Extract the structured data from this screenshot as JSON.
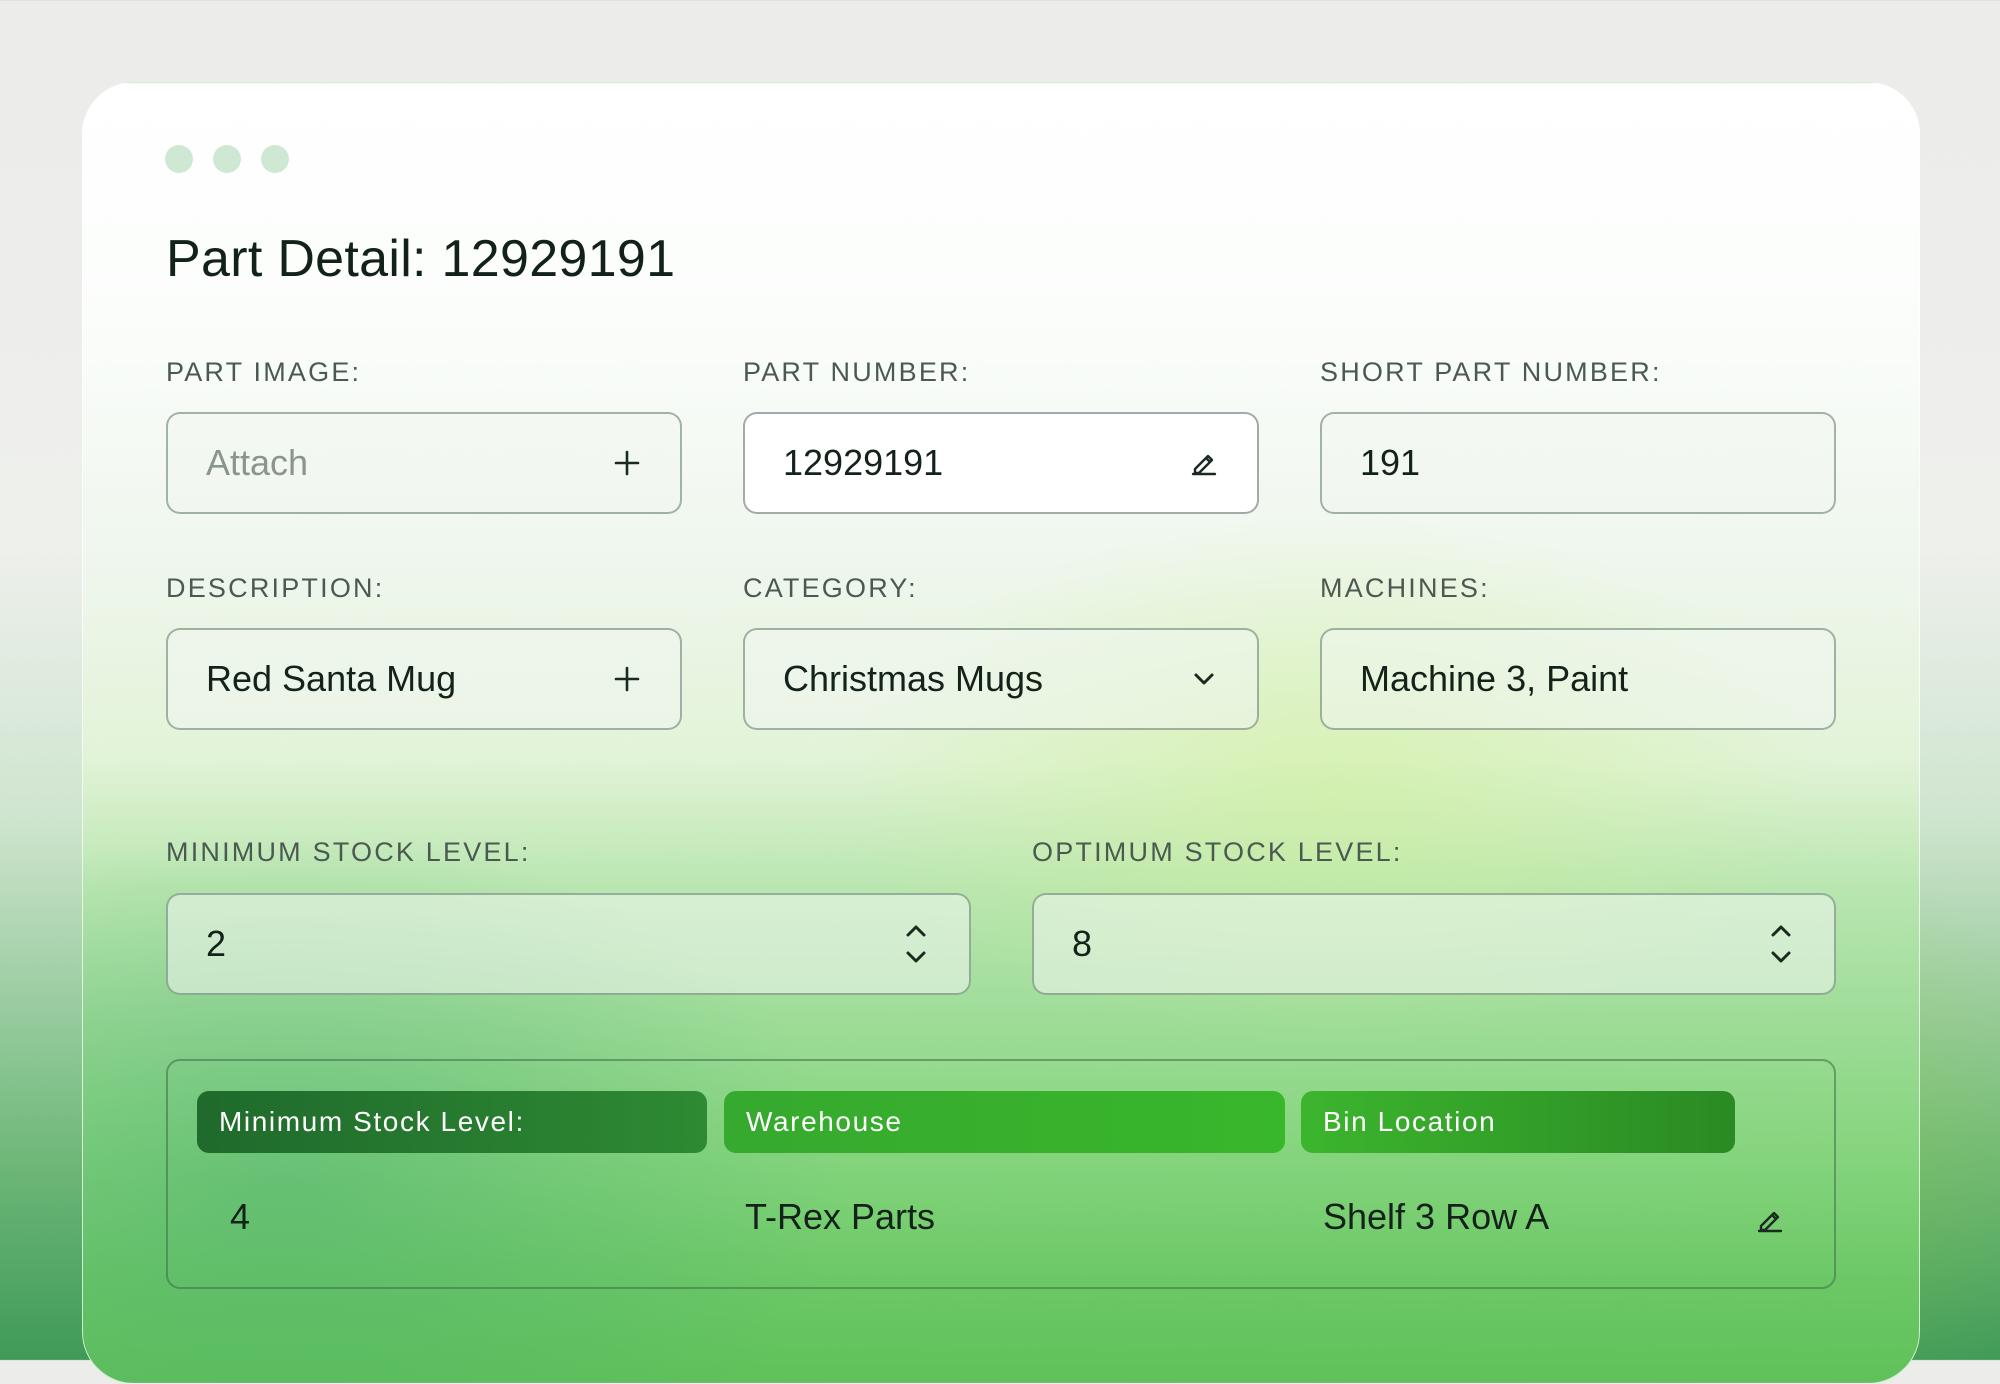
{
  "window": {
    "title": "Part Detail: 12929191"
  },
  "fields": {
    "part_image": {
      "label": "PART IMAGE:",
      "placeholder": "Attach",
      "icon": "plus-icon"
    },
    "part_number": {
      "label": "PART NUMBER:",
      "value": "12929191",
      "icon": "pencil-icon"
    },
    "short_part_number": {
      "label": "SHORT PART NUMBER:",
      "value": "191"
    },
    "description": {
      "label": "DESCRIPTION:",
      "value": "Red Santa Mug",
      "icon": "plus-icon"
    },
    "category": {
      "label": "CATEGORY:",
      "value": "Christmas Mugs",
      "icon": "chevron-down-icon"
    },
    "machines": {
      "label": "MACHINES:",
      "value": "Machine 3, Paint"
    },
    "minimum_stock": {
      "label": "MINIMUM STOCK LEVEL:",
      "value": "2",
      "icon": "stepper-icon"
    },
    "optimum_stock": {
      "label": "OPTIMUM STOCK LEVEL:",
      "value": "8",
      "icon": "stepper-icon"
    }
  },
  "table": {
    "headers": [
      "Minimum Stock Level:",
      "Warehouse",
      "Bin Location"
    ],
    "rows": [
      [
        "4",
        "T-Rex Parts",
        "Shelf 3 Row A"
      ]
    ],
    "row_action_icon": "pencil-icon"
  },
  "colors": {
    "header_dark": "#22742f",
    "header_bright": "#37b12c",
    "window_dot": "#cfe8d3",
    "text": "#14231a"
  }
}
